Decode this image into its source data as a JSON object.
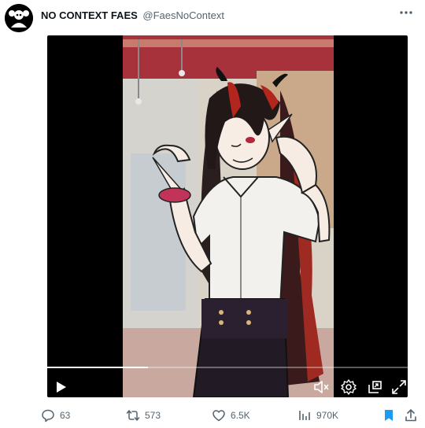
{
  "tweet": {
    "author_name": "NO CONTEXT FAES",
    "author_handle": "@FaesNoContext"
  },
  "video": {
    "progress_fraction": 0.28
  },
  "actions": {
    "replies": "63",
    "retweets": "573",
    "likes": "6.5K",
    "views": "970K"
  },
  "colors": {
    "accent": "#1d9bf0",
    "text": "#0f1419",
    "muted": "#536471"
  }
}
